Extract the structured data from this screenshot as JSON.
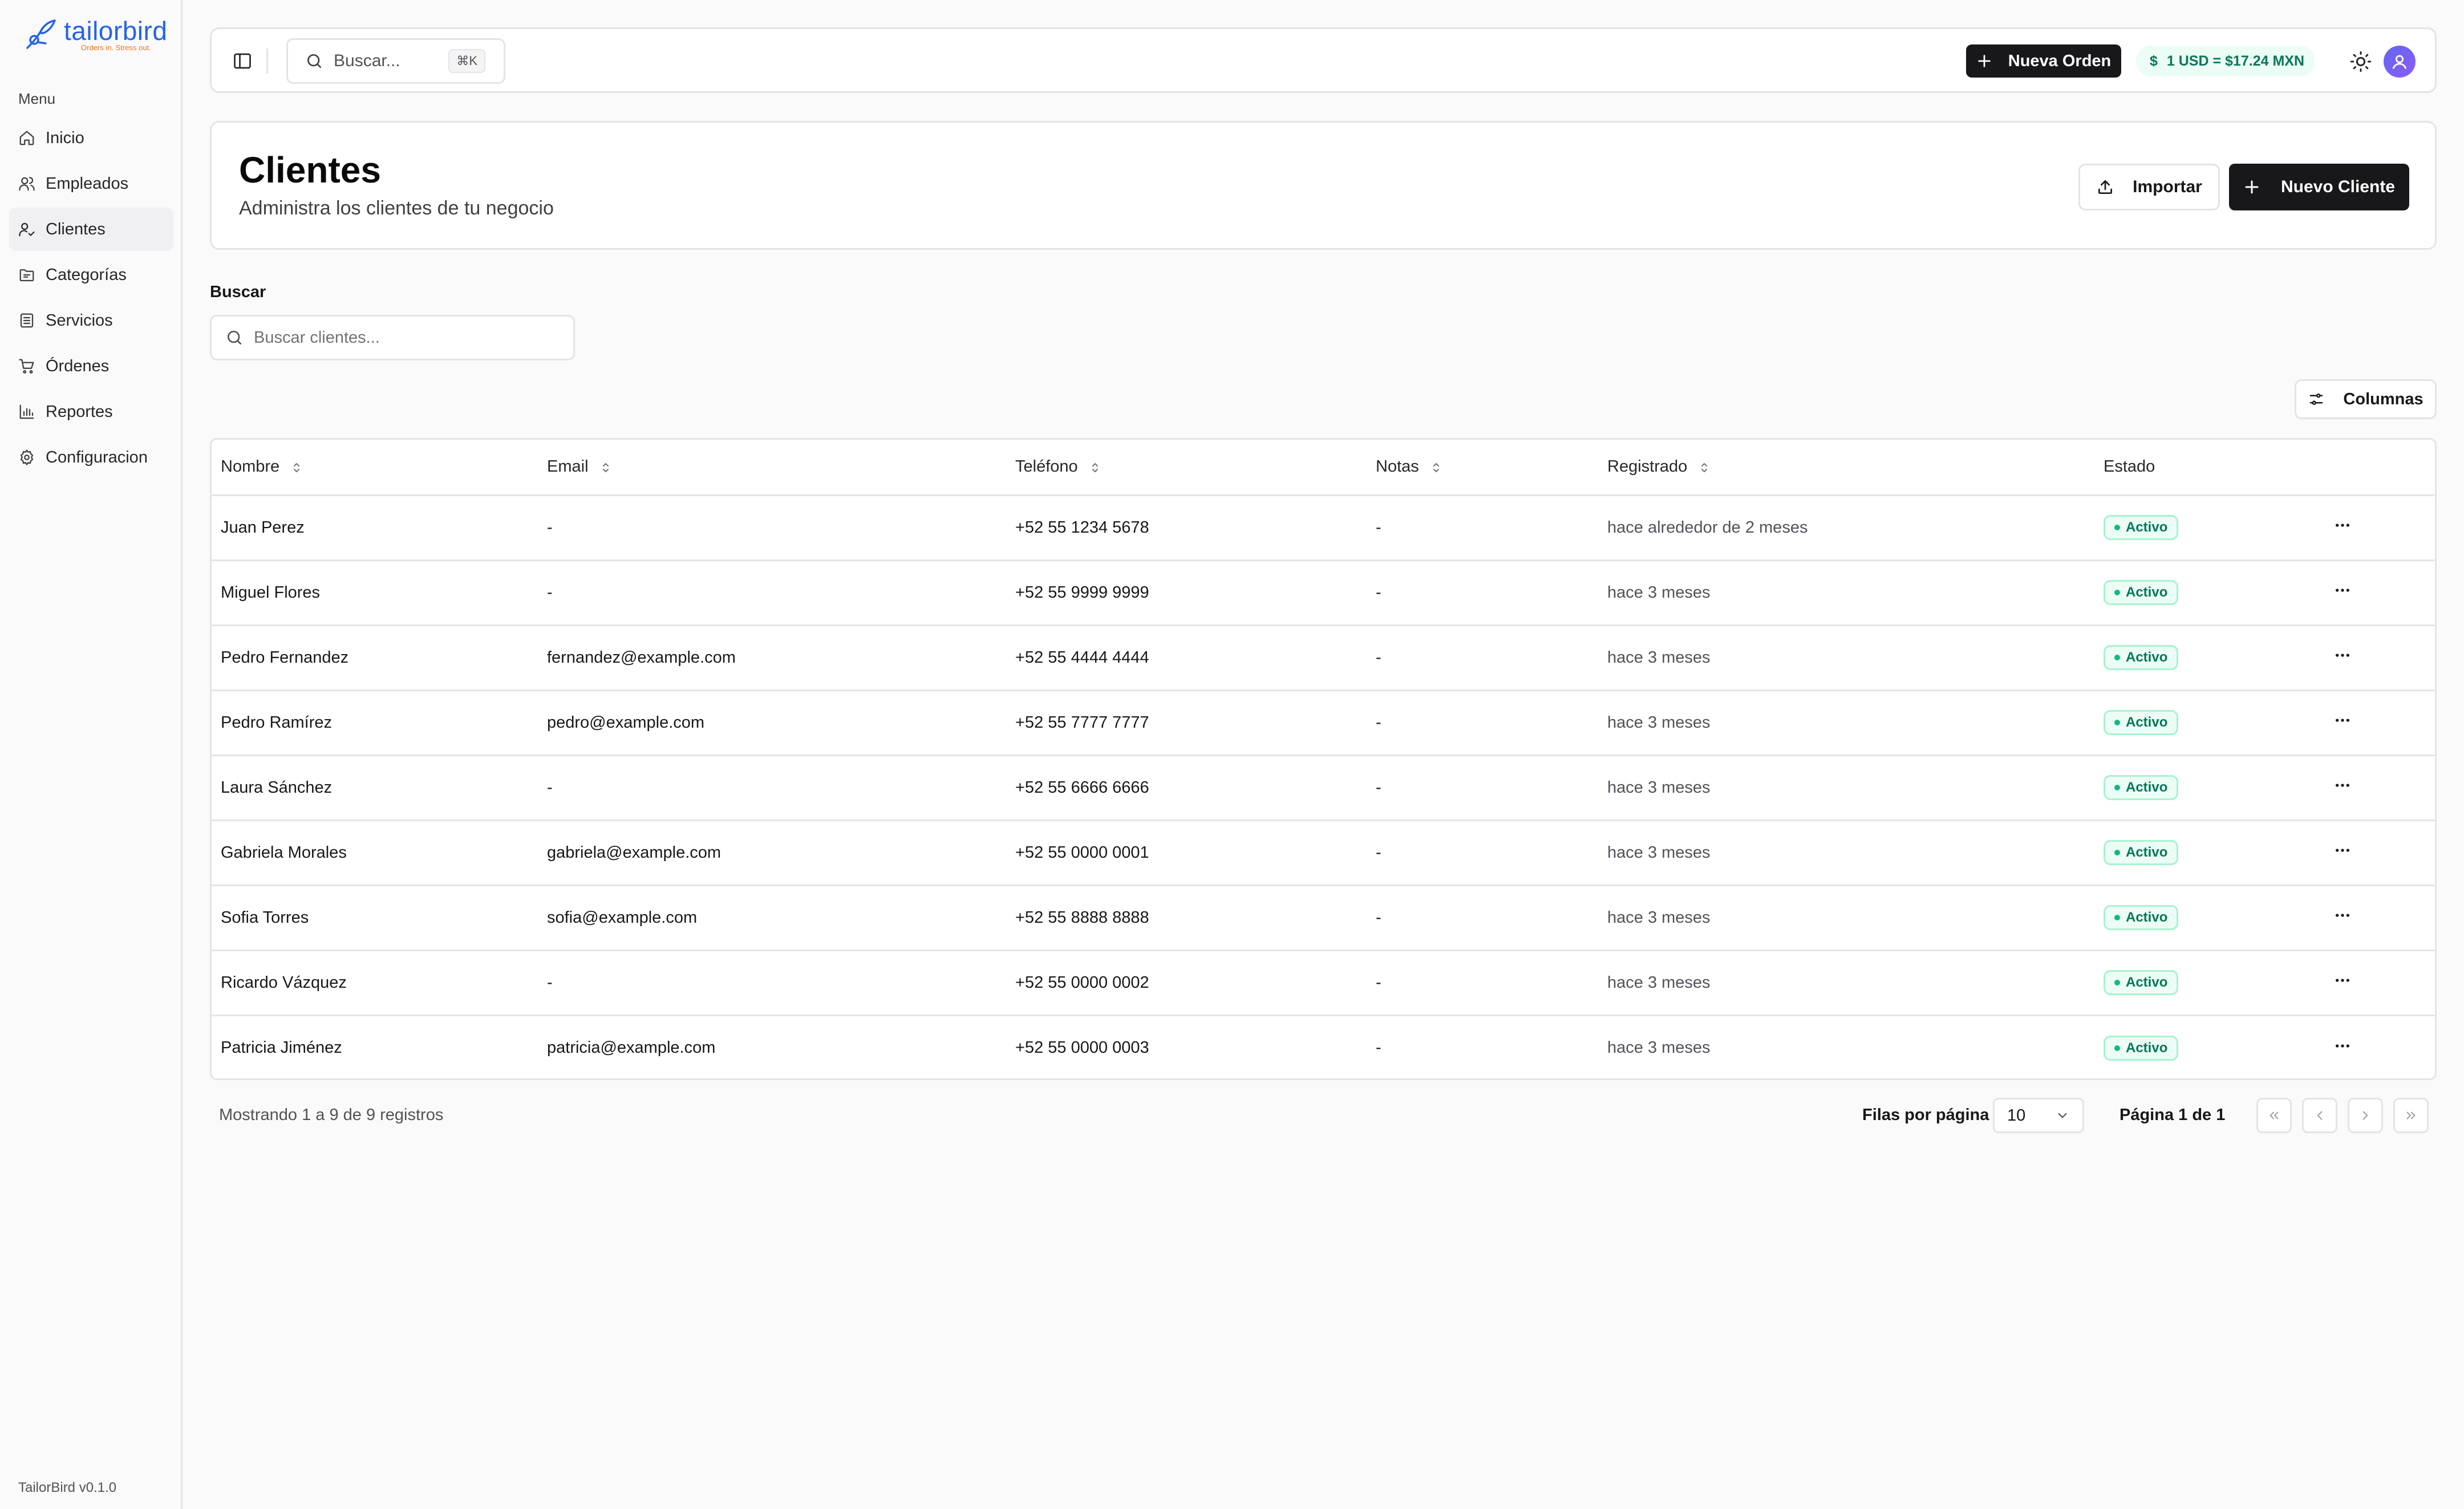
{
  "app": {
    "logo_name": "tailorbird",
    "logo_tagline": "Orders in. Stress out.",
    "menu_label": "Menu",
    "version": "TailorBird v0.1.0"
  },
  "sidebar": {
    "items": [
      {
        "label": "Inicio",
        "icon": "home-icon",
        "active": false
      },
      {
        "label": "Empleados",
        "icon": "users-icon",
        "active": false
      },
      {
        "label": "Clientes",
        "icon": "user-check-icon",
        "active": true
      },
      {
        "label": "Categorías",
        "icon": "folder-icon",
        "active": false
      },
      {
        "label": "Servicios",
        "icon": "list-icon",
        "active": false
      },
      {
        "label": "Órdenes",
        "icon": "cart-icon",
        "active": false
      },
      {
        "label": "Reportes",
        "icon": "bar-chart-icon",
        "active": false
      },
      {
        "label": "Configuracion",
        "icon": "gear-icon",
        "active": false
      }
    ]
  },
  "topbar": {
    "search_placeholder": "Buscar...",
    "shortcut": "⌘K",
    "new_order_label": "Nueva Orden",
    "exchange_rate": "1 USD = $17.24 MXN",
    "exchange_symbol": "$"
  },
  "header": {
    "title": "Clientes",
    "subtitle": "Administra los clientes de tu negocio",
    "import_label": "Importar",
    "new_client_label": "Nuevo Cliente"
  },
  "search": {
    "label": "Buscar",
    "placeholder": "Buscar clientes...",
    "columns_label": "Columnas"
  },
  "table": {
    "columns": [
      "Nombre",
      "Email",
      "Teléfono",
      "Notas",
      "Registrado",
      "Estado"
    ],
    "rows": [
      {
        "name": "Juan Perez",
        "email": "-",
        "phone": "+52 55 1234 5678",
        "notes": "-",
        "registered": "hace alrededor de 2 meses",
        "status": "Activo"
      },
      {
        "name": "Miguel Flores",
        "email": "-",
        "phone": "+52 55 9999 9999",
        "notes": "-",
        "registered": "hace 3 meses",
        "status": "Activo"
      },
      {
        "name": "Pedro Fernandez",
        "email": "fernandez@example.com",
        "phone": "+52 55 4444 4444",
        "notes": "-",
        "registered": "hace 3 meses",
        "status": "Activo"
      },
      {
        "name": "Pedro Ramírez",
        "email": "pedro@example.com",
        "phone": "+52 55 7777 7777",
        "notes": "-",
        "registered": "hace 3 meses",
        "status": "Activo"
      },
      {
        "name": "Laura Sánchez",
        "email": "-",
        "phone": "+52 55 6666 6666",
        "notes": "-",
        "registered": "hace 3 meses",
        "status": "Activo"
      },
      {
        "name": "Gabriela Morales",
        "email": "gabriela@example.com",
        "phone": "+52 55 0000 0001",
        "notes": "-",
        "registered": "hace 3 meses",
        "status": "Activo"
      },
      {
        "name": "Sofia Torres",
        "email": "sofia@example.com",
        "phone": "+52 55 8888 8888",
        "notes": "-",
        "registered": "hace 3 meses",
        "status": "Activo"
      },
      {
        "name": "Ricardo Vázquez",
        "email": "-",
        "phone": "+52 55 0000 0002",
        "notes": "-",
        "registered": "hace 3 meses",
        "status": "Activo"
      },
      {
        "name": "Patricia Jiménez",
        "email": "patricia@example.com",
        "phone": "+52 55 0000 0003",
        "notes": "-",
        "registered": "hace 3 meses",
        "status": "Activo"
      }
    ]
  },
  "pagination": {
    "summary": "Mostrando 1 a 9 de 9 registros",
    "rows_per_page_label": "Filas por página",
    "rows_per_page_value": "10",
    "page_info": "Página 1 de 1"
  },
  "colors": {
    "primary": "#18181b",
    "accent": "#2563eb",
    "success": "#047857",
    "border": "#e4e4e7"
  }
}
